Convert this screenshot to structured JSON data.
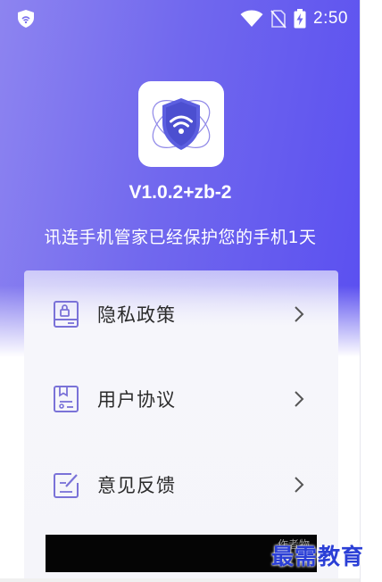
{
  "status_bar": {
    "time": "2:50",
    "icons": [
      "shield-status-icon",
      "wifi-icon",
      "no-sim-icon",
      "battery-charging-icon"
    ]
  },
  "app": {
    "logo_icon": "shield-wifi-logo",
    "version": "V1.0.2+zb-2",
    "protect_message": "讯连手机管家已经保护您的手机1天"
  },
  "menu": {
    "items": [
      {
        "label": "隐私政策",
        "icon": "privacy-document-icon"
      },
      {
        "label": "用户协议",
        "icon": "agreement-document-icon"
      },
      {
        "label": "意见反馈",
        "icon": "feedback-edit-icon"
      }
    ]
  },
  "banner": {
    "text": "作者物"
  },
  "watermark": {
    "text": "最需教育"
  },
  "colors": {
    "gradient_start": "#8d84f0",
    "gradient_end": "#5a4ff0",
    "icon_accent": "#7a72d8",
    "card_bg": "#f5f5fa",
    "watermark": "#2b3fd6"
  }
}
